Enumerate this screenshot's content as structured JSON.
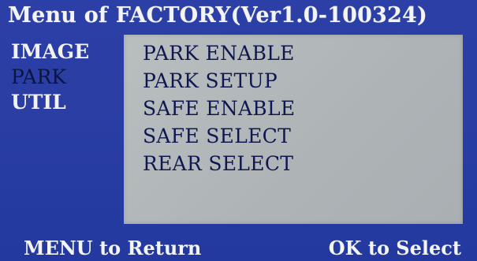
{
  "header": {
    "menu_label": "Menu of",
    "title": "FACTORY(Ver1.0-100324)"
  },
  "categories": [
    {
      "label": "IMAGE",
      "selected": false
    },
    {
      "label": "PARK",
      "selected": true
    },
    {
      "label": "UTIL",
      "selected": false
    }
  ],
  "options": [
    {
      "label": "PARK ENABLE"
    },
    {
      "label": "PARK SETUP"
    },
    {
      "label": "SAFE ENABLE"
    },
    {
      "label": "SAFE SELECT"
    },
    {
      "label": "REAR SELECT"
    }
  ],
  "footer": {
    "left": "MENU to Return",
    "right": "OK to Select"
  },
  "colors": {
    "background": "#2a3ea4",
    "panel": "#b4babb",
    "text_light": "#f4f4f4",
    "text_dark": "#0f1750"
  }
}
